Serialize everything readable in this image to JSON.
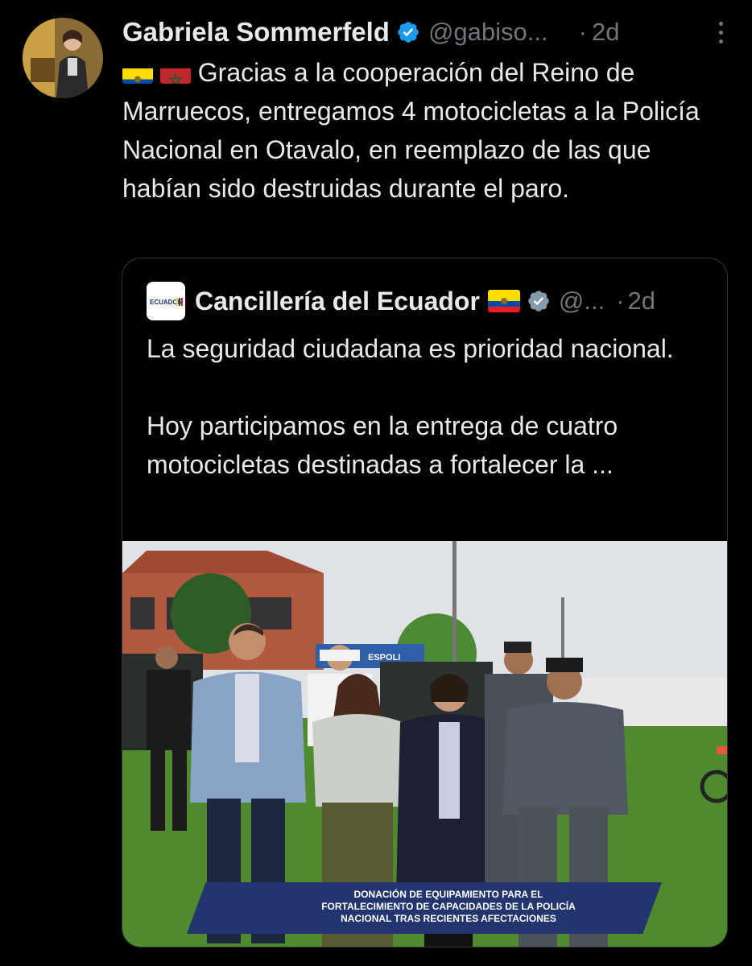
{
  "author": {
    "name": "Gabriela Sommerfeld",
    "handle": "@gabiso...",
    "dot": "·",
    "time": "2d"
  },
  "tweet": {
    "text": "Gracias a la cooperación del Reino de Marruecos, entregamos 4 motocicletas a la Policía Nacional en Otavalo, en reemplazo de las que habían sido destruidas durante el paro."
  },
  "quoted": {
    "name": "Cancillería del Ecuador",
    "handle": "@...",
    "dot": "·",
    "time": "2d",
    "logo_text": "ECUADOR",
    "text_line1": "La seguridad ciudadana es prioridad nacional.",
    "text_line2": "Hoy participamos en la entrega de cuatro motocicletas destinadas a fortalecer la ...",
    "photo": {
      "banner_line1": "DONACIÓN DE EQUIPAMIENTO PARA EL",
      "banner_line2": "FORTALECIMIENTO DE CAPACIDADES DE LA POLICÍA",
      "banner_line3": "NACIONAL TRAS RECIENTES AFECTACIONES",
      "sign_text": "ESPOLI"
    }
  },
  "colors": {
    "background": "#000000",
    "text": "#e7e9ea",
    "secondary": "#71767b",
    "verified": "#1d9bf0",
    "border": "#333639",
    "banner": "#22356e"
  },
  "icons": [
    "verified-badge-icon",
    "more-options-icon",
    "ecuador-flag-icon",
    "morocco-flag-icon"
  ]
}
